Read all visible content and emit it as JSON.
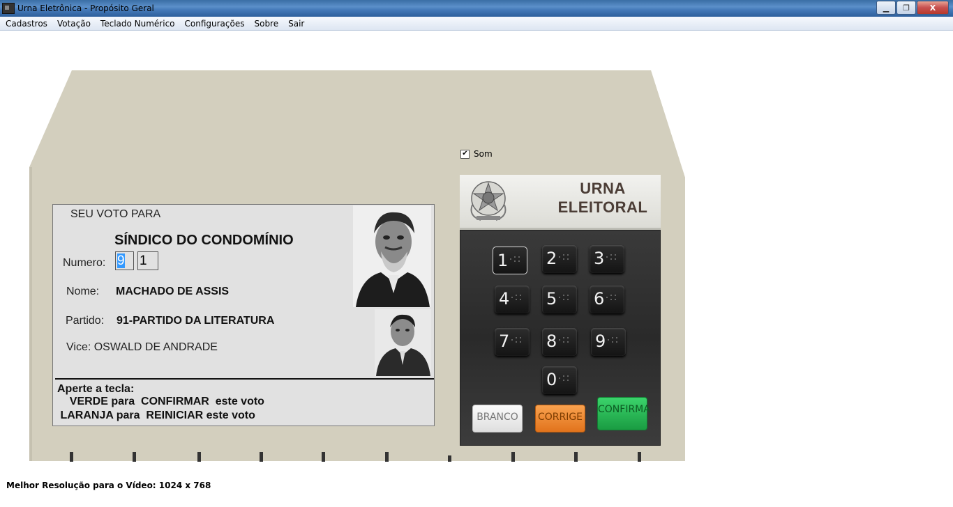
{
  "window": {
    "title": "Urna Eletrônica - Propósito Geral",
    "minimize": "▁",
    "maximize": "❐",
    "close": "X"
  },
  "menu": [
    "Cadastros",
    "Votação",
    "Teclado Numérico",
    "Configurações",
    "Sobre",
    "Sair"
  ],
  "som": {
    "label": "Som",
    "checked": true
  },
  "screen": {
    "header": "SEU VOTO PARA",
    "cargo": "SÍNDICO DO CONDOMÍNIO",
    "numero_label": "Numero:",
    "digit1": "9",
    "digit2": "1",
    "nome_label": "Nome:",
    "nome_value": "MACHADO DE ASSIS",
    "partido_label": "Partido:",
    "partido_value": "91-PARTIDO DA LITERATURA",
    "vice": "Vice: OSWALD DE ANDRADE",
    "instr1": "Aperte a tecla:",
    "instr2": "    VERDE para  CONFIRMAR  este voto",
    "instr3": " LARANJA para  REINICIAR este voto"
  },
  "panel": {
    "title_line1": "URNA",
    "title_line2": "ELEITORAL",
    "keys": [
      "1",
      "2",
      "3",
      "4",
      "5",
      "6",
      "7",
      "8",
      "9",
      "0"
    ],
    "branco": "BRANCO",
    "corrige": "CORRIGE",
    "confirma": "CONFIRMA"
  },
  "colors": {
    "machine_body": "#d3cfbe",
    "title_text": "#4b3d36",
    "confirma_green": "#1a9c42",
    "corrige_orange": "#e1731c"
  },
  "footer": "Melhor Resolução para o Vídeo: 1024 x 768"
}
